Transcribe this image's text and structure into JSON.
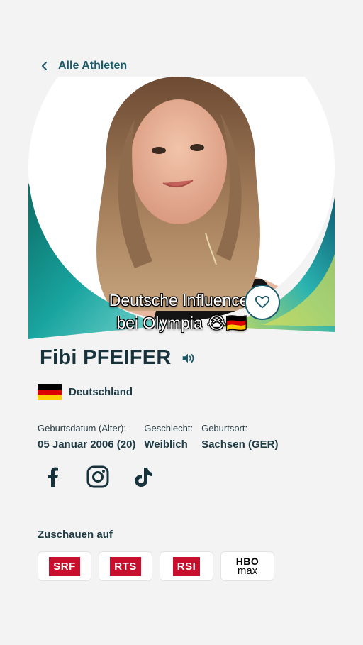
{
  "nav": {
    "back_label": "Alle Athleten"
  },
  "hero": {
    "caption_line1": "Deutsche Influencer",
    "caption_line2": "bei Olympia 😭🇩🇪"
  },
  "athlete": {
    "name": "Fibi PFEIFER",
    "country": "Deutschland",
    "facts": [
      {
        "label": "Geburtsdatum (Alter):",
        "value": "05 Januar 2006 (20)"
      },
      {
        "label": "Geschlecht:",
        "value": "Weiblich"
      },
      {
        "label": "Geburtsort:",
        "value": "Sachsen (GER)"
      }
    ]
  },
  "social": [
    "facebook-icon",
    "instagram-icon",
    "tiktok-icon"
  ],
  "watch": {
    "title": "Zuschauen auf",
    "channels": [
      {
        "name": "SRF",
        "color": "#c8102e"
      },
      {
        "name": "RTS",
        "color": "#c8102e"
      },
      {
        "name": "RSI",
        "color": "#c8102e"
      },
      {
        "name_line1": "HBO",
        "name_line2": "max"
      }
    ]
  },
  "colors": {
    "accent": "#1b5a6a",
    "text": "#1d3b45",
    "background": "#f3f3f3"
  }
}
